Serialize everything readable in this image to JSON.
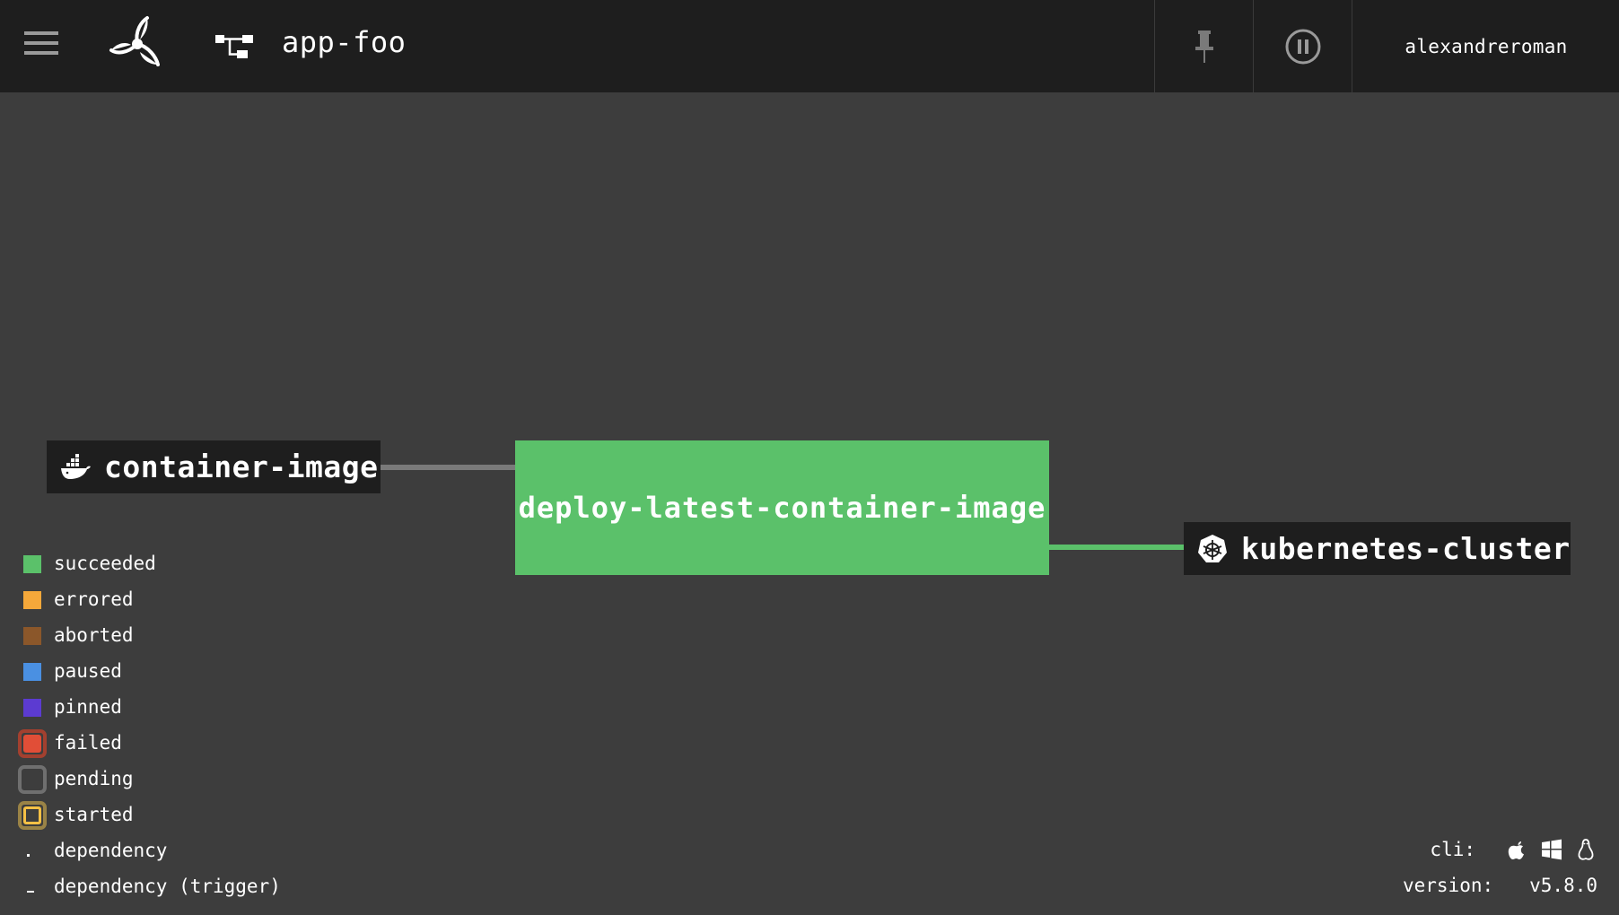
{
  "header": {
    "pipeline_name": "app-foo",
    "username": "alexandreroman"
  },
  "pipeline": {
    "input_resource": {
      "name": "container-image",
      "icon": "docker-icon"
    },
    "job": {
      "name": "deploy-latest-container-image",
      "status": "succeeded",
      "color": "#5bc16a"
    },
    "output_resource": {
      "name": "kubernetes-cluster",
      "icon": "kubernetes-icon"
    }
  },
  "legend": {
    "items": [
      {
        "label": "succeeded",
        "color": "#5bc16a",
        "style": "solid"
      },
      {
        "label": "errored",
        "color": "#f5a83a",
        "style": "solid"
      },
      {
        "label": "aborted",
        "color": "#8b572a",
        "style": "solid"
      },
      {
        "label": "paused",
        "color": "#4a90e2",
        "style": "solid"
      },
      {
        "label": "pinned",
        "color": "#5c3bd1",
        "style": "solid"
      },
      {
        "label": "failed",
        "color": "#e14e37",
        "style": "ring"
      },
      {
        "label": "pending",
        "color": "#9b9b9b",
        "style": "ring"
      },
      {
        "label": "started",
        "color": "#f5c045",
        "style": "ring"
      },
      {
        "label": "dependency",
        "style": "dot"
      },
      {
        "label": "dependency (trigger)",
        "style": "dash"
      }
    ]
  },
  "footer": {
    "cli_label": "cli:",
    "cli_icons": [
      "apple-icon",
      "windows-icon",
      "linux-icon"
    ],
    "version_label": "version:",
    "version_value": "v5.8.0"
  }
}
